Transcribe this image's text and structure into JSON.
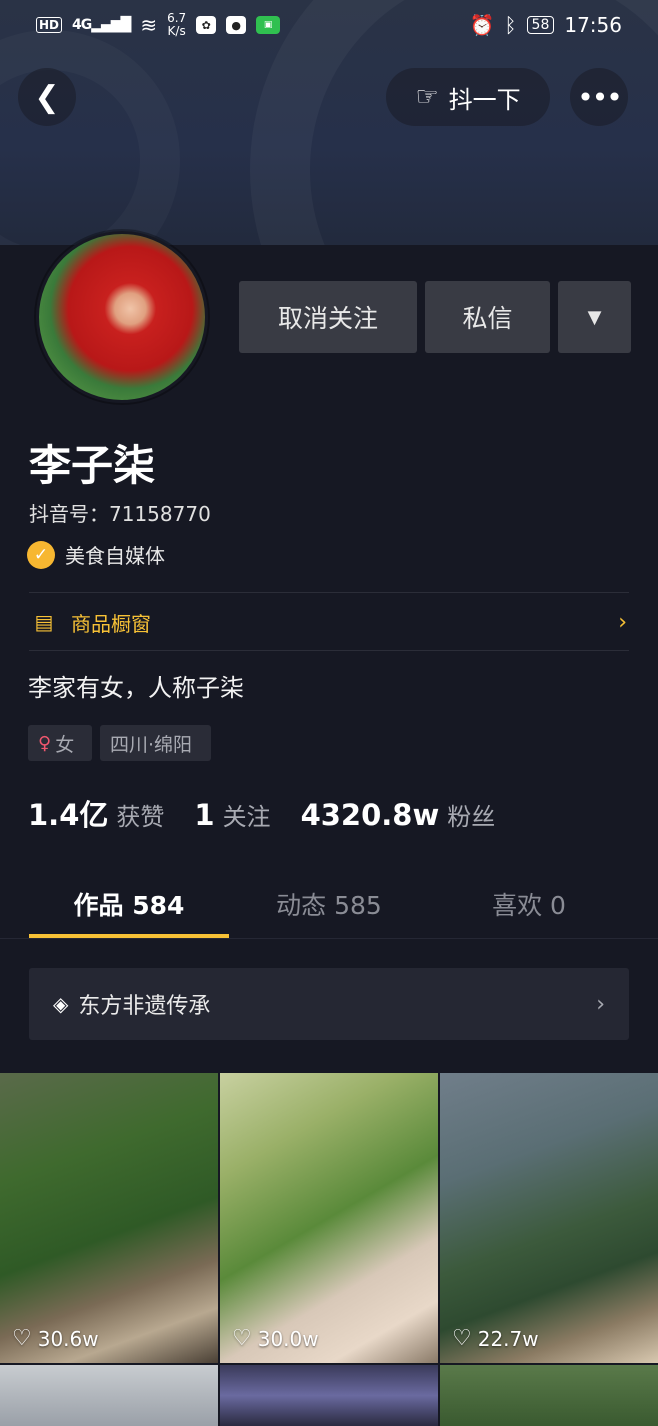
{
  "status_bar": {
    "network": "HD",
    "signal": "4G",
    "speed": "6.7\nK/s",
    "battery": "58",
    "time": "17:56"
  },
  "header": {
    "shake_label": "抖一下"
  },
  "actions": {
    "unfollow_label": "取消关注",
    "message_label": "私信"
  },
  "profile": {
    "name": "李子柒",
    "douyin_id": "抖音号：71158770",
    "verification": "美食自媒体",
    "shop_label": "商品橱窗",
    "bio": "李家有女，人称子柒",
    "gender_tag": "女",
    "location_tag": "四川·绵阳"
  },
  "stats": {
    "likes_num": "1.4亿",
    "likes_label": "获赞",
    "following_num": "1",
    "following_label": "关注",
    "followers_num": "4320.8w",
    "followers_label": "粉丝"
  },
  "tabs": [
    {
      "label": "作品 584",
      "active": true
    },
    {
      "label": "动态 585",
      "active": false
    },
    {
      "label": "喜欢 0",
      "active": false
    }
  ],
  "collection": {
    "label": "东方非遗传承"
  },
  "videos": [
    {
      "likes": "30.6w"
    },
    {
      "likes": "30.0w"
    },
    {
      "likes": "22.7w"
    }
  ],
  "colors": {
    "background": "#161823",
    "accent": "#f7c136",
    "button": "#393b44"
  },
  "icons": {
    "back": "chevron-left-icon",
    "shake": "hand-pointing-icon",
    "more": "more-dots-icon",
    "dropdown": "triangle-down-icon",
    "verify": "check-badge-icon",
    "shop": "shop-icon",
    "collection": "layers-icon",
    "like": "heart-icon"
  }
}
